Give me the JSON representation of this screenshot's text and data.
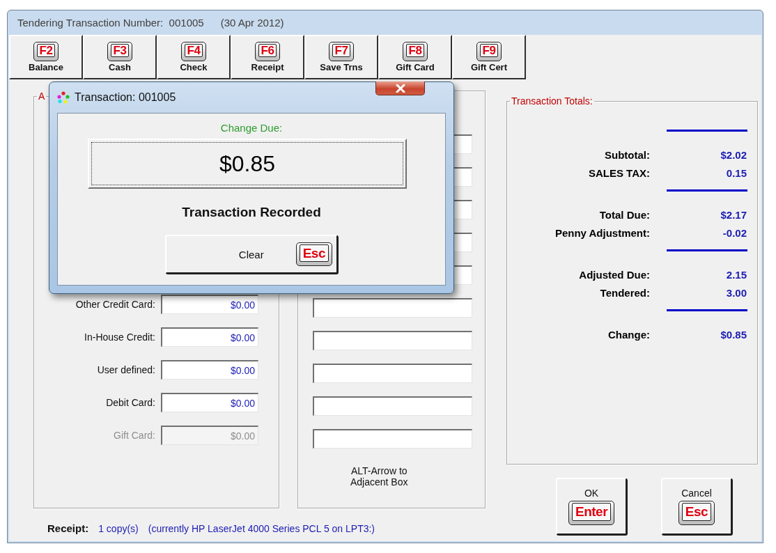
{
  "window": {
    "title": "Tendering Transaction Number:  001005",
    "date": "(30 Apr 2012)"
  },
  "toolbar": [
    {
      "key": "F2",
      "label": "Balance"
    },
    {
      "key": "F3",
      "label": "Cash"
    },
    {
      "key": "F4",
      "label": "Check"
    },
    {
      "key": "F6",
      "label": "Receipt"
    },
    {
      "key": "F7",
      "label": "Save Trns"
    },
    {
      "key": "F8",
      "label": "Gift Card"
    },
    {
      "key": "F9",
      "label": "Gift Cert"
    }
  ],
  "tender_group": {
    "title": "A",
    "rows": [
      {
        "label": "Other Credit Card:",
        "value": "$0.00",
        "disabled": false
      },
      {
        "label": "In-House Credit:",
        "value": "$0.00",
        "disabled": false
      },
      {
        "label": "User defined:",
        "value": "$0.00",
        "disabled": false
      },
      {
        "label": "Debit Card:",
        "value": "$0.00",
        "disabled": false
      },
      {
        "label": "Gift Card:",
        "value": "$0.00",
        "disabled": true
      }
    ]
  },
  "entry_group": {
    "hint": "ALT-Arrow to\nAdjacent Box"
  },
  "totals": {
    "title": "Transaction Totals:",
    "groups": [
      [
        {
          "label": "Subtotal:",
          "value": "$2.02"
        },
        {
          "label": "SALES TAX:",
          "value": "0.15"
        }
      ],
      [
        {
          "label": "Total Due:",
          "value": "$2.17"
        },
        {
          "label": "Penny Adjustment:",
          "value": "-0.02"
        }
      ],
      [
        {
          "label": "Adjusted Due:",
          "value": "2.15"
        },
        {
          "label": "Tendered:",
          "value": "3.00"
        }
      ],
      [
        {
          "label": "Change:",
          "value": "$0.85"
        }
      ]
    ]
  },
  "buttons": [
    {
      "label": "OK",
      "key": "Enter"
    },
    {
      "label": "Cancel",
      "key": "Esc"
    }
  ],
  "receipt": {
    "label": "Receipt:",
    "copies": "1 copy(s)",
    "printer": "(currently HP LaserJet 4000 Series PCL 5 on LPT3:)"
  },
  "dialog": {
    "title": "Transaction: 001005",
    "caption": "Change Due:",
    "amount": "$0.85",
    "message": "Transaction Recorded",
    "button": {
      "label": "Clear",
      "key": "Esc"
    }
  }
}
